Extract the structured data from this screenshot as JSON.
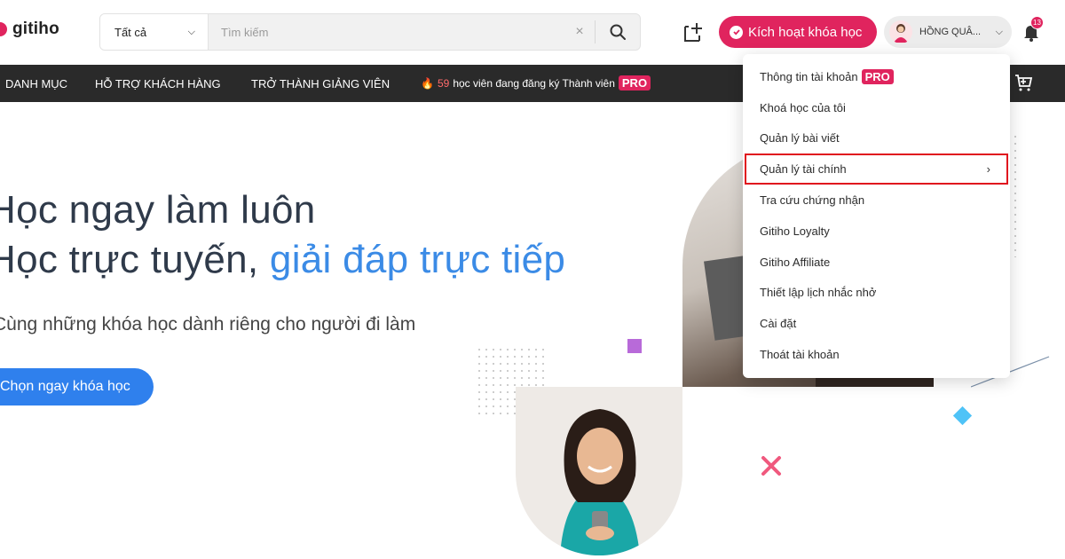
{
  "header": {
    "logo_text": "gitiho",
    "search": {
      "category": "Tất cả",
      "placeholder": "Tìm kiếm"
    },
    "activate_label": "Kích hoạt khóa học",
    "user_name": "HỒNG QUÂ...",
    "notification_count": "13",
    "icons": [
      "add-icon",
      "search-icon",
      "clear-icon",
      "bell-icon",
      "cart-icon",
      "check-circle-icon",
      "chevron-down-icon"
    ]
  },
  "nav": {
    "items": [
      "DANH MỤC",
      "HỖ TRỢ KHÁCH HÀNG",
      "TRỞ THÀNH GIẢNG VIÊN"
    ],
    "promo": {
      "count": "59",
      "text": "học viên đang đăng ký Thành viên",
      "badge": "PRO"
    }
  },
  "hero": {
    "line1": "Học ngay làm luôn",
    "line2_plain": "Học trực tuyến,",
    "line2_accent": "giải đáp trực tiếp",
    "subtitle": "Cùng những khóa học dành riêng cho người đi làm",
    "cta": "Chọn ngay khóa học"
  },
  "dropdown": {
    "items": [
      {
        "label": "Thông tin tài khoản",
        "badge": "PRO"
      },
      {
        "label": "Khoá học của tôi"
      },
      {
        "label": "Quản lý bài viết"
      },
      {
        "label": "Quản lý tài chính",
        "arrow": "›",
        "highlighted": true
      },
      {
        "label": "Tra cứu chứng nhận"
      },
      {
        "label": "Gitiho Loyalty"
      },
      {
        "label": "Gitiho Affiliate"
      },
      {
        "label": "Thiết lập lịch nhắc nhở"
      },
      {
        "label": "Cài đặt"
      },
      {
        "label": "Thoát tài khoản"
      }
    ]
  },
  "colors": {
    "brand_pink": "#e0245e",
    "nav_bg": "#2a2a2a",
    "accent_blue": "#3b8be6",
    "cta_blue": "#2f80ed",
    "highlight_red": "#e0141e"
  }
}
